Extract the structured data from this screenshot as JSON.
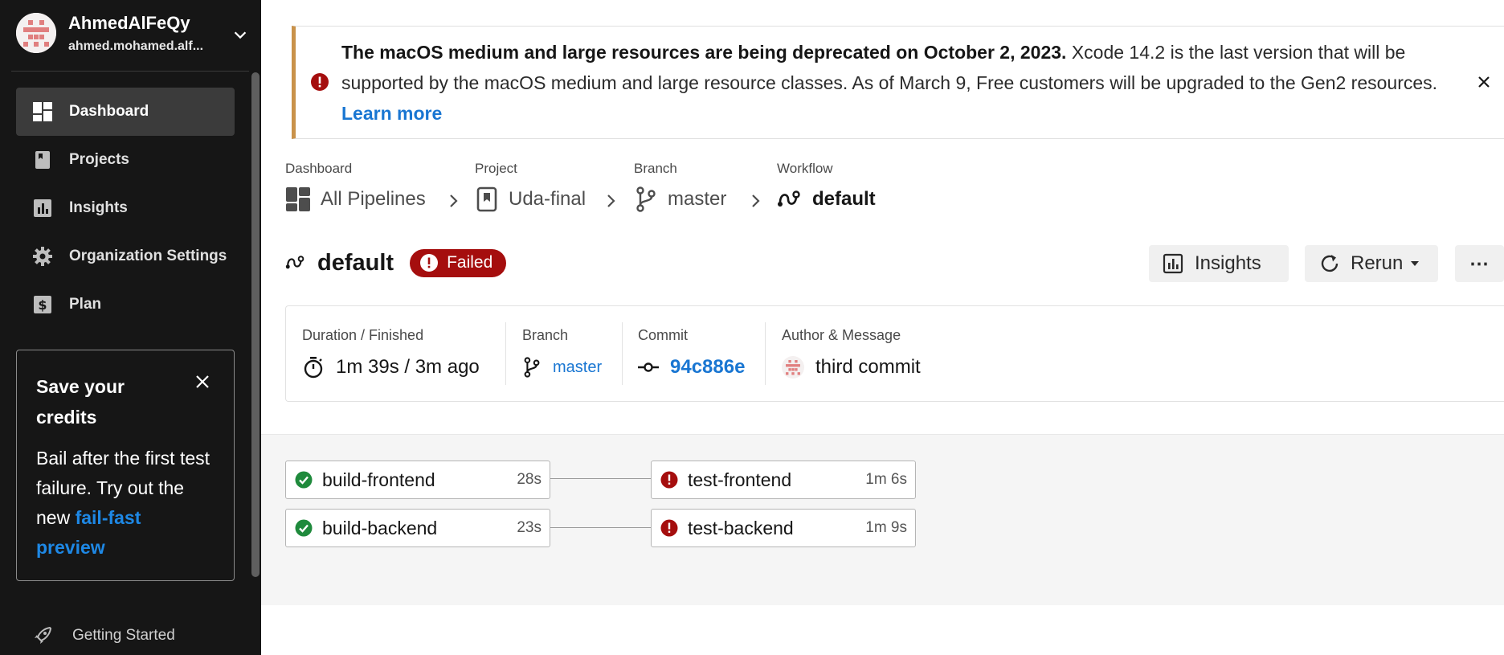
{
  "sidebar": {
    "org_name": "AhmedAlFeQy",
    "org_email": "ahmed.mohamed.alf...",
    "items": [
      {
        "label": "Dashboard",
        "icon": "dashboard-icon",
        "active": true
      },
      {
        "label": "Projects",
        "icon": "projects-icon"
      },
      {
        "label": "Insights",
        "icon": "insights-icon"
      },
      {
        "label": "Organization Settings",
        "icon": "gear-icon"
      },
      {
        "label": "Plan",
        "icon": "dollar-icon"
      }
    ],
    "promo": {
      "title": "Save your credits",
      "body": "Bail after the first test failure. Try out the new",
      "link": "fail-fast preview"
    },
    "getting_started": "Getting Started"
  },
  "banner": {
    "bold": "The macOS medium and large resources are being deprecated on October 2, 2023.",
    "text": " Xcode 14.2 is the last version that will be supported by the macOS medium and large resource classes. As of March 9, Free customers will be upgraded to the Gen2 resources. ",
    "link": "Learn more"
  },
  "breadcrumbs": [
    {
      "label": "Dashboard",
      "value": "All Pipelines",
      "icon": "pipelines-icon"
    },
    {
      "label": "Project",
      "value": "Uda-final",
      "icon": "bookmark-icon"
    },
    {
      "label": "Branch",
      "value": "master",
      "icon": "branch-icon"
    },
    {
      "label": "Workflow",
      "value": "default",
      "icon": "workflow-icon"
    }
  ],
  "workflow": {
    "name": "default",
    "status": "Failed"
  },
  "actions": {
    "insights": "Insights",
    "rerun": "Rerun",
    "more": "⋯"
  },
  "details": {
    "duration_label": "Duration / Finished",
    "duration_value": "1m 39s / 3m ago",
    "branch_label": "Branch",
    "branch_value": "master",
    "commit_label": "Commit",
    "commit_value": "94c886e",
    "author_label": "Author & Message",
    "author_value": "third commit"
  },
  "jobs": [
    {
      "name": "build-frontend",
      "time": "28s",
      "status": "success"
    },
    {
      "name": "build-backend",
      "time": "23s",
      "status": "success"
    },
    {
      "name": "test-frontend",
      "time": "1m 6s",
      "status": "failed"
    },
    {
      "name": "test-backend",
      "time": "1m 9s",
      "status": "failed"
    }
  ],
  "colors": {
    "failed": "#a50e0e",
    "success": "#1f8a3c",
    "link": "#1976d2",
    "sidebar": "#161616",
    "banner_accent": "#c9924a"
  }
}
